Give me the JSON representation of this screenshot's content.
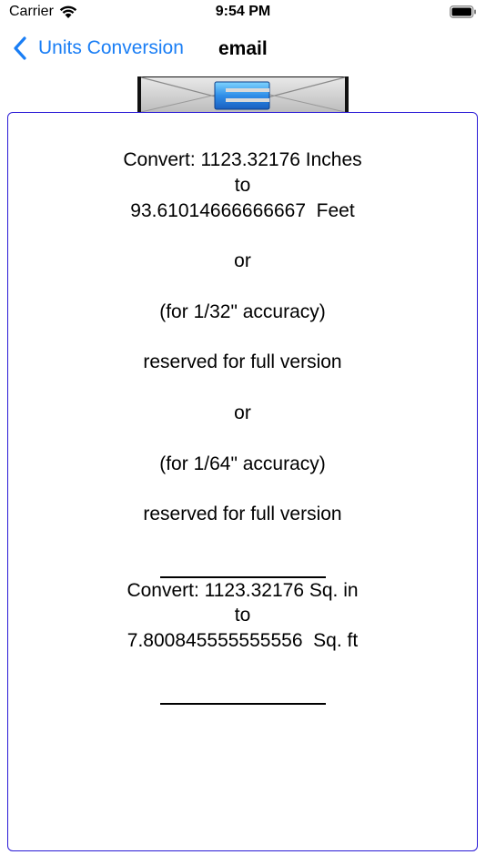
{
  "status_bar": {
    "carrier": "Carrier",
    "time": "9:54 PM"
  },
  "nav": {
    "back_label": "Units Conversion",
    "title": "email"
  },
  "colors": {
    "accent": "#1a7ef5",
    "panel_border": "#2a1ad6"
  },
  "conversion": {
    "line1": "Convert: 1123.32176 Inches",
    "line2": "to",
    "line3": "93.61014666666667  Feet",
    "or1": "or",
    "acc32": "(for 1/32\" accuracy)",
    "reserved1": "reserved for full version",
    "or2": "or",
    "acc64": "(for 1/64\" accuracy)",
    "reserved2": "reserved for full version",
    "sq_line1": "Convert: 1123.32176 Sq. in",
    "sq_line2": "to",
    "sq_line3": "7.800845555555556  Sq. ft"
  }
}
